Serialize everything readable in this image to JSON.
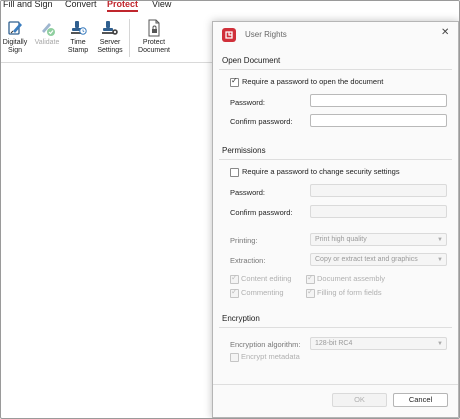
{
  "menu": {
    "tabs": [
      {
        "label": "Fill and Sign"
      },
      {
        "label": "Convert"
      },
      {
        "label": "Protect"
      },
      {
        "label": "View"
      }
    ]
  },
  "ribbon": {
    "buttons": [
      {
        "line1": "Digitally",
        "line2": "Sign",
        "icon": "digital-sign-icon"
      },
      {
        "line1": "Validate",
        "line2": "",
        "icon": "validate-icon"
      },
      {
        "line1": "Time",
        "line2": "Stamp",
        "icon": "time-stamp-icon"
      },
      {
        "line1": "Server",
        "line2": "Settings",
        "icon": "server-settings-icon"
      },
      {
        "line1": "Protect",
        "line2": "Document",
        "icon": "protect-document-icon"
      }
    ]
  },
  "dialog": {
    "title": "User Rights",
    "open_document": {
      "heading": "Open Document",
      "require_label": "Require a password to open the document",
      "require_checked": true,
      "password_label": "Password:",
      "confirm_label": "Confirm password:"
    },
    "permissions": {
      "heading": "Permissions",
      "require_label": "Require a password to change security settings",
      "require_checked": false,
      "password_label": "Password:",
      "confirm_label": "Confirm password:",
      "printing_label": "Printing:",
      "printing_value": "Print high quality",
      "extraction_label": "Extraction:",
      "extraction_value": "Copy or extract text and graphics",
      "content_editing": "Content editing",
      "document_assembly": "Document assembly",
      "commenting": "Commenting",
      "filling_form_fields": "Filling of form fields"
    },
    "encryption": {
      "heading": "Encryption",
      "algorithm_label": "Encryption algorithm:",
      "algorithm_value": "128-bit RC4",
      "encrypt_metadata": "Encrypt metadata"
    },
    "ok_label": "OK",
    "cancel_label": "Cancel"
  },
  "colors": {
    "accent": "#c0262d",
    "app_icon": "#d0303a"
  }
}
